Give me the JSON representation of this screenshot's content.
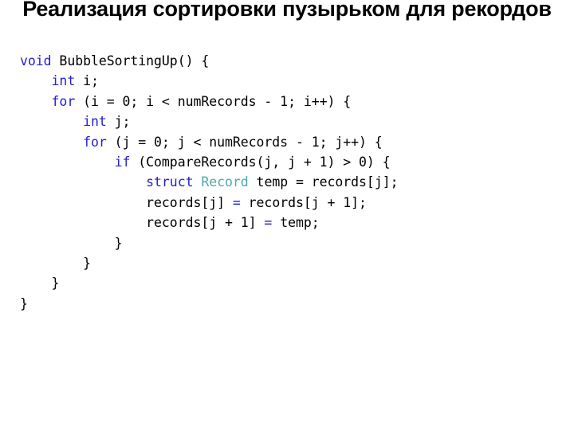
{
  "slide": {
    "title": "Реализация сортировки пузырьком для рекордов",
    "background_color": "#ffffff",
    "title_color": "#000000"
  },
  "colors": {
    "keyword": "#2320CE",
    "type": "#4FA8AC",
    "operator": "#2320CE",
    "plain": "#000000"
  },
  "code": {
    "language": "c",
    "full_text": "void BubbleSortingUp() {\n    int i;\n    for (i = 0; i < numRecords - 1; i++) {\n        int j;\n        for (j = 0; j < numRecords - 1; j++) {\n            if (CompareRecords(j, j + 1) > 0) {\n                struct Record temp = records[j];\n                records[j] = records[j + 1];\n                records[j + 1] = temp;\n            }\n        }\n    }\n}",
    "lines": [
      {
        "indent": 0,
        "tokens": [
          {
            "t": "void",
            "c": "kw"
          },
          {
            "t": " BubbleSortingUp() {",
            "c": "plain"
          }
        ]
      },
      {
        "indent": 1,
        "tokens": [
          {
            "t": "int",
            "c": "kw"
          },
          {
            "t": " i;",
            "c": "plain"
          }
        ]
      },
      {
        "indent": 1,
        "tokens": [
          {
            "t": "for",
            "c": "kw"
          },
          {
            "t": " (i = 0; i < numRecords - 1; i++) {",
            "c": "plain"
          }
        ]
      },
      {
        "indent": 2,
        "tokens": [
          {
            "t": "int",
            "c": "kw"
          },
          {
            "t": " j;",
            "c": "plain"
          }
        ]
      },
      {
        "indent": 2,
        "tokens": [
          {
            "t": "for",
            "c": "kw"
          },
          {
            "t": " (j = 0; j < numRecords - 1; j++) {",
            "c": "plain"
          }
        ]
      },
      {
        "indent": 3,
        "tokens": [
          {
            "t": "if",
            "c": "kw"
          },
          {
            "t": " (CompareRecords(j, j + 1) > 0) {",
            "c": "plain"
          }
        ]
      },
      {
        "indent": 4,
        "tokens": [
          {
            "t": "struct",
            "c": "kw"
          },
          {
            "t": " ",
            "c": "plain"
          },
          {
            "t": "Record",
            "c": "type"
          },
          {
            "t": " temp = records[j];",
            "c": "plain"
          }
        ]
      },
      {
        "indent": 4,
        "tokens": [
          {
            "t": "records[j] ",
            "c": "plain"
          },
          {
            "t": "=",
            "c": "op"
          },
          {
            "t": " records[j + 1];",
            "c": "plain"
          }
        ]
      },
      {
        "indent": 4,
        "tokens": [
          {
            "t": "records[j + 1] ",
            "c": "plain"
          },
          {
            "t": "=",
            "c": "op"
          },
          {
            "t": " temp;",
            "c": "plain"
          }
        ]
      },
      {
        "indent": 3,
        "tokens": [
          {
            "t": "}",
            "c": "plain"
          }
        ]
      },
      {
        "indent": 2,
        "tokens": [
          {
            "t": "}",
            "c": "plain"
          }
        ]
      },
      {
        "indent": 1,
        "tokens": [
          {
            "t": "}",
            "c": "plain"
          }
        ]
      },
      {
        "indent": 0,
        "tokens": [
          {
            "t": "}",
            "c": "plain"
          }
        ]
      }
    ]
  }
}
